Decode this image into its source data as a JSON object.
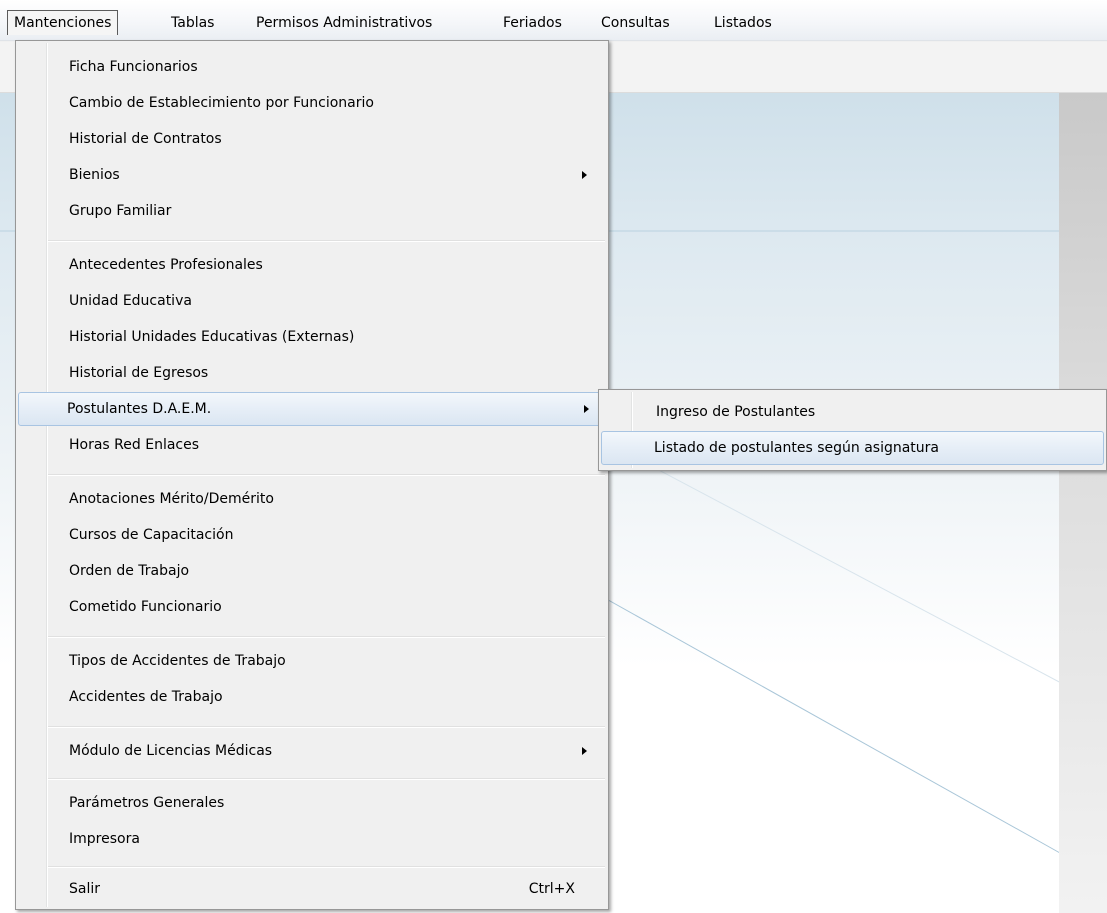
{
  "menubar": {
    "items": [
      "Mantenciones",
      "Tablas",
      "Permisos Administrativos",
      "Feriados",
      "Consultas",
      "Listados"
    ],
    "active_index": 0
  },
  "main_menu": {
    "items": [
      {
        "label": "Ficha Funcionarios"
      },
      {
        "label": "Cambio de Establecimiento por Funcionario"
      },
      {
        "label": "Historial de Contratos"
      },
      {
        "label": "Bienios",
        "submenu_arrow": true
      },
      {
        "label": "Grupo Familiar"
      },
      {
        "label": "Antecedentes Profesionales"
      },
      {
        "label": "Unidad Educativa"
      },
      {
        "label": "Historial Unidades Educativas (Externas)"
      },
      {
        "label": "Historial de Egresos"
      },
      {
        "label": "Postulantes D.A.E.M.",
        "submenu_arrow": true,
        "highlighted": true
      },
      {
        "label": "Horas Red Enlaces"
      },
      {
        "label": "Anotaciones Mérito/Demérito"
      },
      {
        "label": "Cursos de Capacitación"
      },
      {
        "label": "Orden de Trabajo"
      },
      {
        "label": "Cometido Funcionario"
      },
      {
        "label": "Tipos de Accidentes de Trabajo"
      },
      {
        "label": "Accidentes de Trabajo"
      },
      {
        "label": "Módulo de Licencias Médicas",
        "submenu_arrow": true
      },
      {
        "label": "Parámetros Generales"
      },
      {
        "label": "Impresora"
      },
      {
        "label": "Salir",
        "shortcut": "Ctrl+X"
      }
    ]
  },
  "submenu_postulantes": {
    "items": [
      {
        "label": "Ingreso de Postulantes"
      },
      {
        "label": "Listado de postulantes según asignatura",
        "highlighted": true
      }
    ]
  },
  "colors": {
    "menu_background": "#f0f0f0",
    "highlight_border": "#a8c4e2",
    "menu_border": "#979797"
  }
}
